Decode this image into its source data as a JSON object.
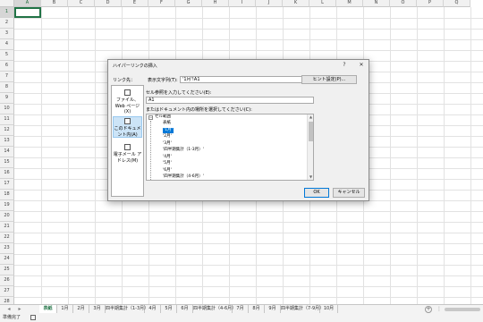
{
  "columns": [
    "A",
    "B",
    "C",
    "D",
    "E",
    "F",
    "G",
    "H",
    "I",
    "J",
    "K",
    "L",
    "M",
    "N",
    "O",
    "P",
    "Q"
  ],
  "rows": [
    "1",
    "2",
    "3",
    "4",
    "5",
    "6",
    "7",
    "8",
    "9",
    "10",
    "11",
    "12",
    "13",
    "14",
    "15",
    "16",
    "17",
    "18",
    "19",
    "20",
    "21",
    "22",
    "23",
    "24",
    "25",
    "26",
    "27",
    "28"
  ],
  "dialog": {
    "title": "ハイパーリンクの挿入",
    "help": "?",
    "close": "✕",
    "link_to_label": "リンク先：",
    "display_text_label": "表示文字列(T):",
    "display_text_value": "'1月'!A1",
    "screentip_button": "ヒント設定(P)...",
    "cellref_label": "セル参照を入力してください(E):",
    "cellref_value": "A1",
    "place_label": "またはドキュメント内の場所を選択してください(C):",
    "link_types": [
      {
        "label": "ファイル、Web ページ(X)",
        "icon": "globe-file-icon"
      },
      {
        "label": "このドキュメント内(A)",
        "icon": "document-icon"
      },
      {
        "label": "電子メール アドレス(M)",
        "icon": "email-icon"
      }
    ],
    "tree_root": "セル範囲",
    "tree_items": [
      "表紙",
      "'1月'",
      "'2月'",
      "'3月'",
      "'四半期集計（1-3月）'",
      "'4月'",
      "'5月'",
      "'6月'",
      "'四半期集計（4-6月）'"
    ],
    "ok": "OK",
    "cancel": "キャンセル"
  },
  "tabs": [
    "表紙",
    "1月",
    "2月",
    "3月",
    "四半期集計（1-3月）",
    "4月",
    "5月",
    "6月",
    "四半期集計（4-6月）",
    "7月",
    "8月",
    "9月",
    "四半期集計（7-9月）",
    "10月"
  ],
  "status_text": "準備完了"
}
